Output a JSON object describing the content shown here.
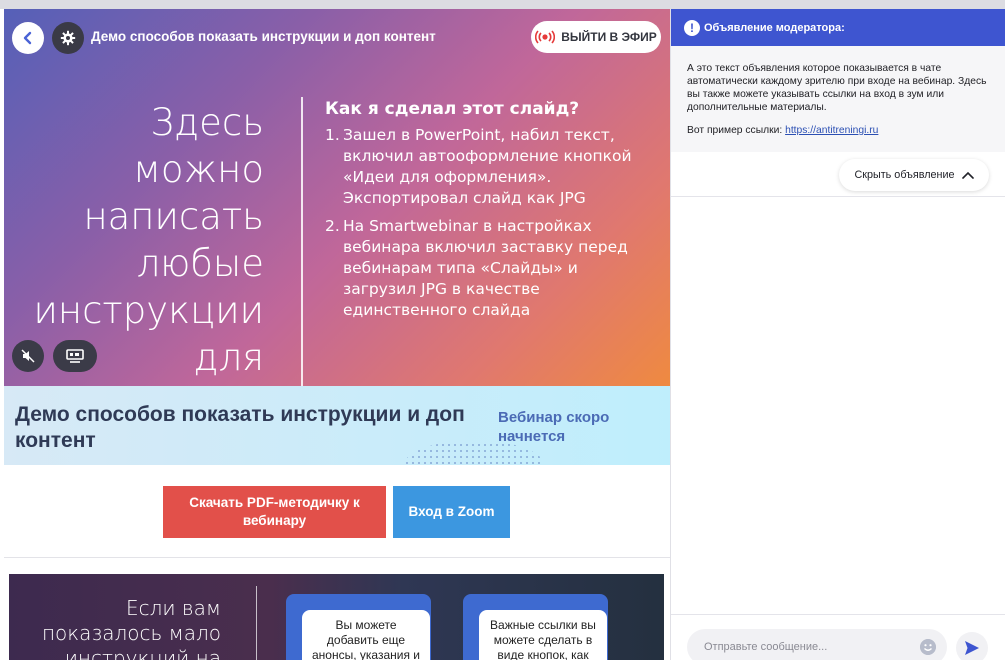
{
  "stream": {
    "title": "Демо способов показать инструкции и доп контент",
    "live_button": "ВЫЙТИ В ЭФИР"
  },
  "slide": {
    "left_text": "Здесь можно написать любые инструкции для зрителей",
    "right_title": "Как я сделал этот слайд?",
    "steps": [
      {
        "num": "1.",
        "text": "Зашел в PowerPoint, набил текст, включил автооформление кнопкой «Идеи для оформления». Экспортировал слайд как JPG"
      },
      {
        "num": "2.",
        "text": "На Smartwebinar в настройках вебинара включил заставку перед вебинарам типа «Слайды» и загрузил JPG в качестве единственного слайда"
      }
    ]
  },
  "banner": {
    "title": "Демо способов показать инструкции и доп контент",
    "soon": "Вебинар скоро начнется"
  },
  "buttons": {
    "pdf": "Скачать PDF-методичку к вебинару",
    "zoom": "Вход в Zoom"
  },
  "slide2": {
    "text": "Если вам показалось мало инструкций на",
    "card1": "Вы можете добавить еще анонсы, указания и инструкции в виде",
    "card2": "Важные ссылки вы можете сделать в виде кнопок, как показано"
  },
  "chat": {
    "announce_title": "Объявление модератора:",
    "announce_text": "А это текст объявления которое показывается в чате автоматически каждому зрителю при входе на вебинар. Здесь вы также можете указывать ссылки на вход в зум или дополнительные материалы.",
    "example_prefix": "Вот пример ссылки:",
    "example_link": "https://antitreningi.ru",
    "hide_button": "Скрыть объявление",
    "input_placeholder": "Отправьте сообщение..."
  },
  "icons": {
    "back": "chevron-left-icon",
    "settings": "gear-icon",
    "live": "broadcast-icon",
    "mute": "speaker-muted-icon",
    "screen": "screen-layout-icon",
    "collapse": "chevron-up-icon",
    "emoji": "emoji-icon",
    "send": "send-icon"
  },
  "colors": {
    "accent": "#3e55d0",
    "pdf_button": "#e2504a",
    "zoom_button": "#3c97e0",
    "live_red": "#e53a3a"
  }
}
